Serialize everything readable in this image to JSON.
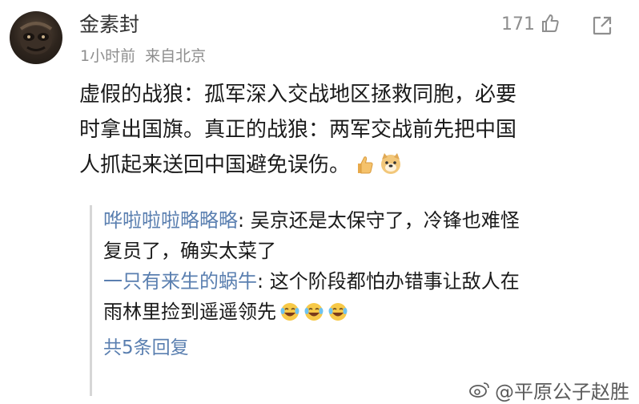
{
  "comment": {
    "username": "金素封",
    "time": "1小时前",
    "location": "来自北京",
    "like_count": "171",
    "lines": [
      "虚假的战狼：孤军深入交战地区拯救同胞，必要",
      "时拿出国旗。真正的战狼：两军交战前先把中国",
      "人抓起来送回中国避免误伤。"
    ]
  },
  "replies": [
    {
      "user": "哗啦啦啦略略略",
      "lines": [
        ": 吴京还是太保守了，冷锋也难怪",
        "复员了，确实太菜了"
      ]
    },
    {
      "user": "一只有来生的蜗牛",
      "lines": [
        ": 这个阶段都怕办错事让敌人在",
        "雨林里捡到遥遥领先"
      ]
    }
  ],
  "more_replies": "共5条回复",
  "watermark": "@平原公子赵胜",
  "colors": {
    "link": "#5a7fb0",
    "meta": "#8e8e8e",
    "divider": "#d6d6d6"
  },
  "icons": [
    "thumbs-up-icon",
    "share-icon",
    "thumb-emoji-icon",
    "doge-emoji-icon",
    "laugh-cry-emoji-icon"
  ]
}
